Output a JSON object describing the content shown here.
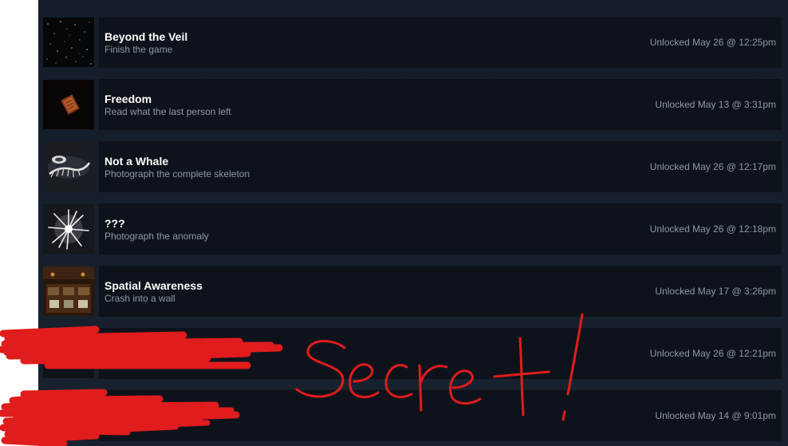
{
  "achievements": [
    {
      "title": "Beyond the Veil",
      "description": "Finish the game",
      "unlocked": "Unlocked May 26 @ 12:25pm",
      "icon": "starfield-icon"
    },
    {
      "title": "Freedom",
      "description": "Read what the last person left",
      "unlocked": "Unlocked May 13 @ 3:31pm",
      "icon": "note-icon"
    },
    {
      "title": "Not a Whale",
      "description": "Photograph the complete skeleton",
      "unlocked": "Unlocked May 26 @ 12:17pm",
      "icon": "skeleton-icon"
    },
    {
      "title": "???",
      "description": "Photograph the anomaly",
      "unlocked": "Unlocked May 26 @ 12:18pm",
      "icon": "anomaly-icon"
    },
    {
      "title": "Spatial Awareness",
      "description": "Crash into a wall",
      "unlocked": "Unlocked May 17 @ 3:26pm",
      "icon": "cockpit-icon"
    },
    {
      "title": "",
      "description": "",
      "unlocked": "Unlocked May 26 @ 12:21pm",
      "icon": "redacted-icon"
    },
    {
      "title": "",
      "description": "",
      "unlocked": "Unlocked May 14 @ 9:01pm",
      "icon": "redacted-icon"
    }
  ],
  "annotation": {
    "text": "Secret!",
    "color": "#e01c1c"
  },
  "colors": {
    "panel": "#18222f",
    "card": "#0e131b",
    "title": "#ffffff",
    "subtext": "#8f98a0"
  }
}
